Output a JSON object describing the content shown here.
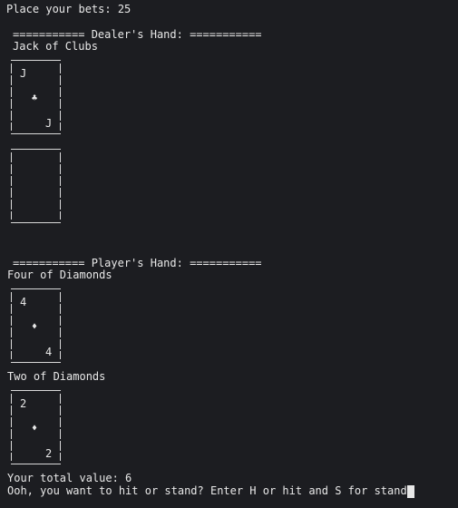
{
  "terminal": {
    "bet_line": "Place your bets: 25",
    "dealer_header": "=========== Dealer's Hand: ===========",
    "dealer_card_1": {
      "name": "Jack of Clubs",
      "rank": "J",
      "suit": "♣"
    },
    "dealer_card_2": {
      "name": "",
      "rank": "",
      "suit": ""
    },
    "player_header": "=========== Player's Hand: ===========",
    "player_card_1": {
      "name": "Four of Diamonds",
      "rank": "4",
      "suit": "♦"
    },
    "player_card_2": {
      "name": "Two of Diamonds",
      "rank": "2",
      "suit": "♦"
    },
    "total_line": "Your total value: 6",
    "prompt_line": "Ooh, you want to hit or stand? Enter H or hit and S for stand:"
  }
}
